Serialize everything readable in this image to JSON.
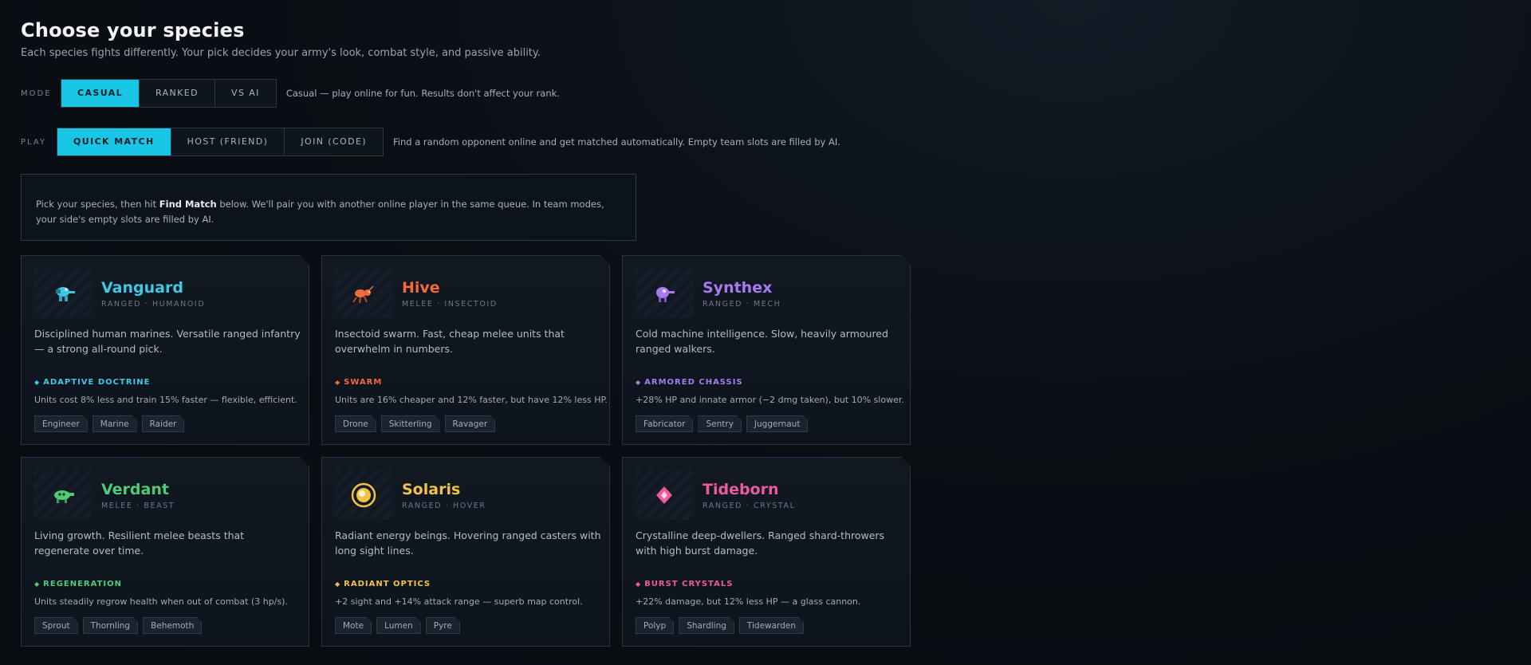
{
  "header": {
    "title": "Choose your species",
    "subtitle": "Each species fights differently. Your pick decides your army's look, combat style, and passive ability."
  },
  "mode": {
    "label": "MODE",
    "options": [
      "CASUAL",
      "RANKED",
      "VS AI"
    ],
    "selected": "CASUAL",
    "description": "Casual — play online for fun. Results don't affect your rank."
  },
  "play": {
    "label": "PLAY",
    "options": [
      "QUICK MATCH",
      "HOST (FRIEND)",
      "JOIN (CODE)"
    ],
    "selected": "QUICK MATCH",
    "description": "Find a random opponent online and get matched automatically. Empty team slots are filled by AI."
  },
  "info": {
    "prefix": "Pick your species, then hit ",
    "highlight": "Find Match",
    "suffix": " below. We'll pair you with another online player in the same queue. In team modes, your side's empty slots are filled by AI."
  },
  "accent_color": "#19c6e6",
  "species": [
    {
      "name": "Vanguard",
      "type": "RANGED · HUMANOID",
      "color": "#3fc8e4",
      "icon": "marine-icon",
      "description": "Disciplined human marines. Versatile ranged infantry — a strong all-round pick.",
      "trait": "ADAPTIVE DOCTRINE",
      "trait_desc": "Units cost 8% less and train 15% faster — flexible, efficient.",
      "units": [
        "Engineer",
        "Marine",
        "Raider"
      ]
    },
    {
      "name": "Hive",
      "type": "MELEE · INSECTOID",
      "color": "#f06a3c",
      "icon": "insect-icon",
      "description": "Insectoid swarm. Fast, cheap melee units that overwhelm in numbers.",
      "trait": "SWARM",
      "trait_desc": "Units are 16% cheaper and 12% faster, but have 12% less HP.",
      "units": [
        "Drone",
        "Skitterling",
        "Ravager"
      ]
    },
    {
      "name": "Synthex",
      "type": "RANGED · MECH",
      "color": "#a77af0",
      "icon": "mech-icon",
      "description": "Cold machine intelligence. Slow, heavily armoured ranged walkers.",
      "trait": "ARMORED CHASSIS",
      "trait_desc": "+28% HP and innate armor (−2 dmg taken), but 10% slower.",
      "units": [
        "Fabricator",
        "Sentry",
        "Juggernaut"
      ]
    },
    {
      "name": "Verdant",
      "type": "MELEE · BEAST",
      "color": "#4ecb78",
      "icon": "beast-icon",
      "description": "Living growth. Resilient melee beasts that regenerate over time.",
      "trait": "REGENERATION",
      "trait_desc": "Units steadily regrow health when out of combat (3 hp/s).",
      "units": [
        "Sprout",
        "Thornling",
        "Behemoth"
      ]
    },
    {
      "name": "Solaris",
      "type": "RANGED · HOVER",
      "color": "#f2c246",
      "icon": "sun-orb-icon",
      "description": "Radiant energy beings. Hovering ranged casters with long sight lines.",
      "trait": "RADIANT OPTICS",
      "trait_desc": "+2 sight and +14% attack range — superb map control.",
      "units": [
        "Mote",
        "Lumen",
        "Pyre"
      ]
    },
    {
      "name": "Tideborn",
      "type": "RANGED · CRYSTAL",
      "color": "#ee5b9c",
      "icon": "crystal-icon",
      "description": "Crystalline deep-dwellers. Ranged shard-throwers with high burst damage.",
      "trait": "BURST CRYSTALS",
      "trait_desc": "+22% damage, but 12% less HP — a glass cannon.",
      "units": [
        "Polyp",
        "Shardling",
        "Tidewarden"
      ]
    }
  ]
}
